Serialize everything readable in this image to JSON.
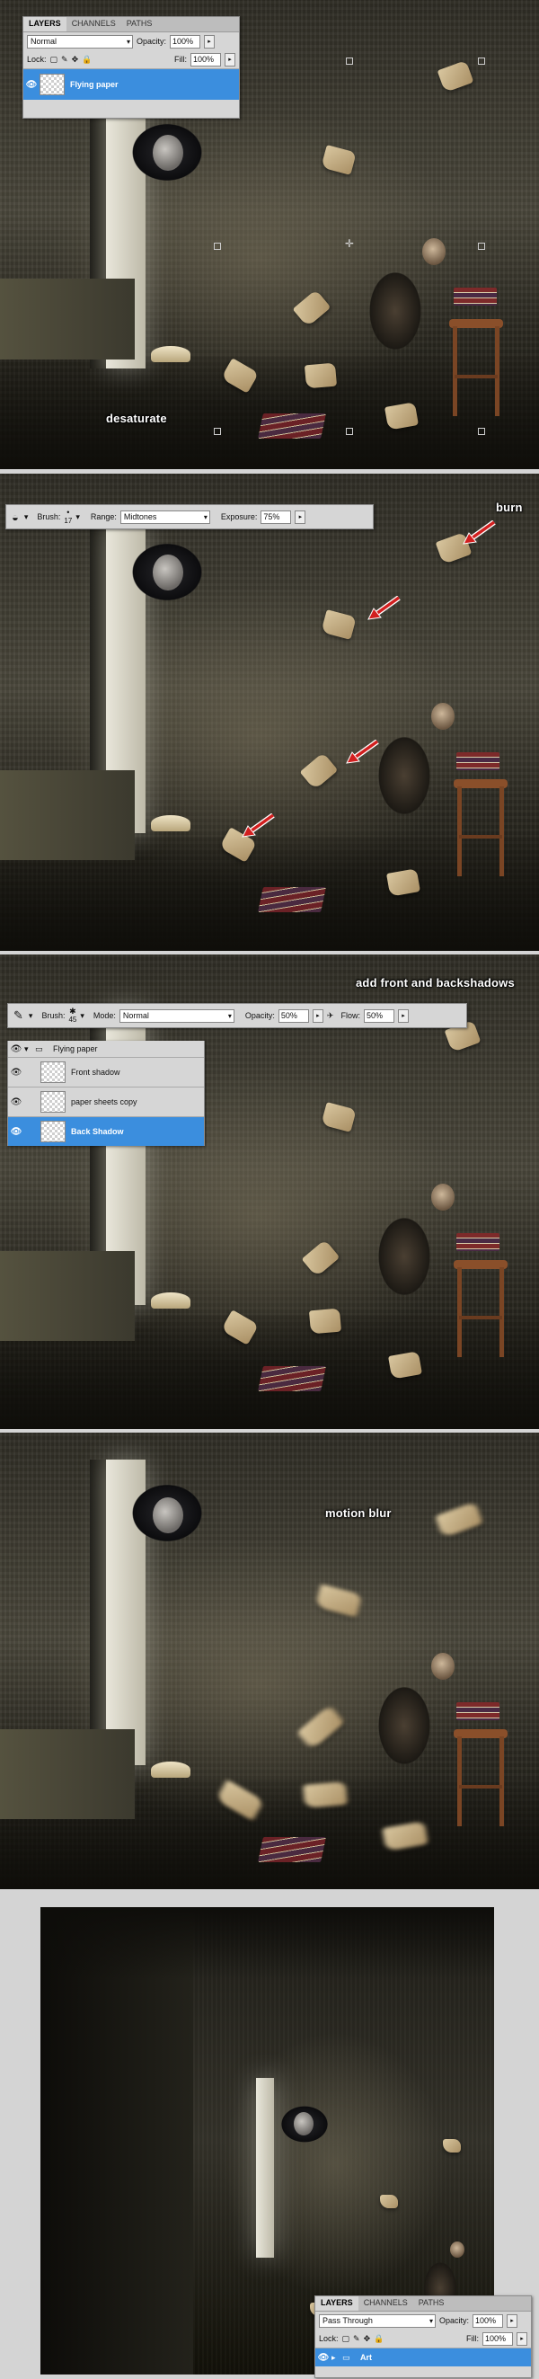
{
  "panel1": {
    "caption": "desaturate",
    "layers_panel": {
      "tabs": [
        "LAYERS",
        "CHANNELS",
        "PATHS"
      ],
      "blend_mode": "Normal",
      "opacity_label": "Opacity:",
      "opacity_value": "100%",
      "lock_label": "Lock:",
      "fill_label": "Fill:",
      "fill_value": "100%",
      "layer_name": "Flying paper"
    }
  },
  "panel2": {
    "caption": "burn",
    "options_bar": {
      "brush_label": "Brush:",
      "brush_size": "17",
      "range_label": "Range:",
      "range_value": "Midtones",
      "exposure_label": "Exposure:",
      "exposure_value": "75%"
    }
  },
  "panel3": {
    "caption": "add front and backshadows",
    "options_bar": {
      "brush_label": "Brush:",
      "brush_size": "45",
      "mode_label": "Mode:",
      "mode_value": "Normal",
      "opacity_label": "Opacity:",
      "opacity_value": "50%",
      "flow_label": "Flow:",
      "flow_value": "50%"
    },
    "layers": {
      "group_name": "Flying paper",
      "items": [
        "Front shadow",
        "paper sheets copy",
        "Back Shadow"
      ]
    }
  },
  "panel4": {
    "caption": "motion blur"
  },
  "panel5": {
    "layers_panel": {
      "tabs": [
        "LAYERS",
        "CHANNELS",
        "PATHS"
      ],
      "blend_mode": "Pass Through",
      "opacity_label": "Opacity:",
      "opacity_value": "100%",
      "lock_label": "Lock:",
      "fill_label": "Fill:",
      "fill_value": "100%",
      "layer_name": "Art"
    }
  },
  "colors": {
    "selection_blue": "#3b8ede",
    "arrow_red": "#d21f1f",
    "paper": "#c9b38a"
  }
}
